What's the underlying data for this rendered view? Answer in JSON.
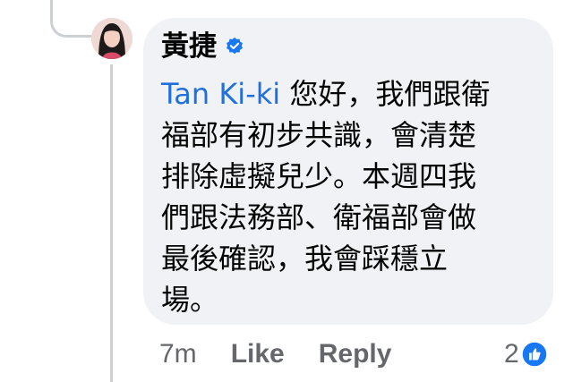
{
  "comment": {
    "author": "黃捷",
    "author_verified": true,
    "mention": "Tan Ki-ki",
    "lines": [
      " 您好，我們跟衛",
      "福部有初步共識，會清楚",
      "排除虛擬兒少。本週四我",
      "們跟法務部、衛福部會做",
      "最後確認，我會踩穩立",
      "場。"
    ],
    "time": "7m",
    "like_label": "Like",
    "reply_label": "Reply",
    "reaction_count": "2",
    "reaction_type": "like-icon"
  },
  "colors": {
    "bubble": "#f0f2f5",
    "mention": "#216fdb",
    "meta": "#65676b",
    "badge": "#1877f2"
  }
}
